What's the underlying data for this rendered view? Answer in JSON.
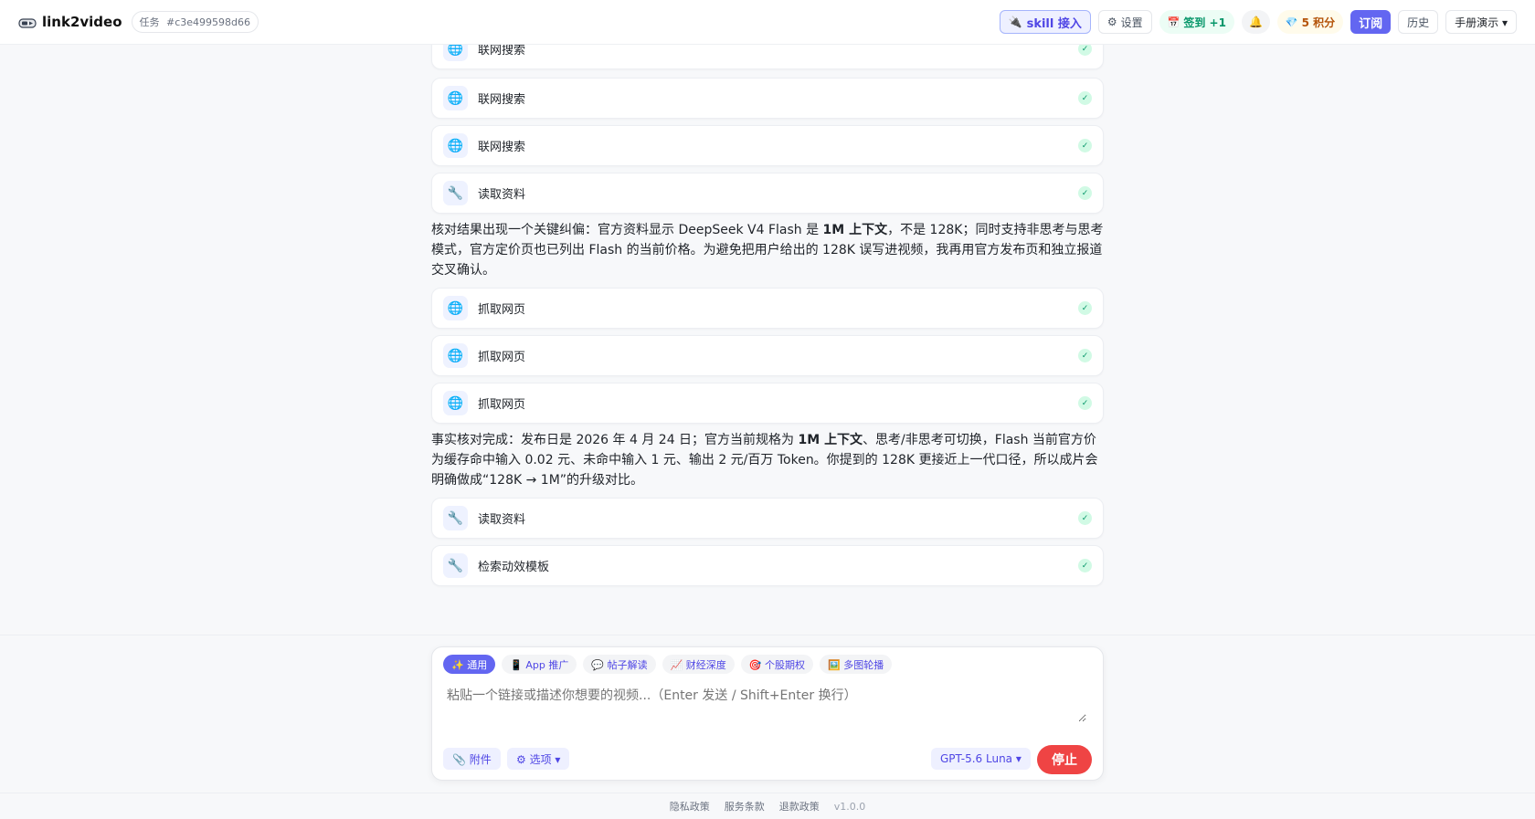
{
  "header": {
    "app_name": "link2video",
    "task_label": "任务",
    "task_id": "#c3e499598d66",
    "skill_label": "skill 接入",
    "settings_label": "设置",
    "checkin_label": "签到 +1",
    "points_label": "5 积分",
    "subscribe_label": "订阅",
    "history_label": "历史",
    "manual_label": "手册演示 ▾"
  },
  "tools": [
    {
      "label": "联网搜索",
      "icon": "globe-icon"
    },
    {
      "label": "联网搜索",
      "icon": "globe-icon"
    },
    {
      "label": "联网搜索",
      "icon": "globe-icon"
    },
    {
      "label": "读取资料",
      "icon": "wrench-icon"
    },
    {
      "label": "抓取网页",
      "icon": "globe-icon"
    },
    {
      "label": "抓取网页",
      "icon": "globe-icon"
    },
    {
      "label": "抓取网页",
      "icon": "globe-icon"
    },
    {
      "label": "读取资料",
      "icon": "wrench-icon"
    },
    {
      "label": "检索动效模板",
      "icon": "wrench-icon"
    }
  ],
  "messages": {
    "m1_a": "核对结果出现一个关键纠偏：官方资料显示 DeepSeek V4 Flash 是 ",
    "m1_bold": "1M 上下文",
    "m1_b": "，不是 128K；同时支持非思考与思考模式，官方定价页也已列出 Flash 的当前价格。为避免把用户给出的 128K 误写进视频，我再用官方发布页和独立报道交叉确认。",
    "m2_a": "事实核对完成：发布日是 2026 年 4 月 24 日；官方当前规格为 ",
    "m2_bold": "1M 上下文",
    "m2_b": "、思考/非思考可切换，Flash 当前官方价为缓存命中输入 0.02 元、未命中输入 1 元、输出 2 元/百万 Token。你提到的 128K 更接近上一代口径，所以成片会明确做成“128K → 1M”的升级对比。"
  },
  "composer": {
    "modes": [
      {
        "label": "✨ 通用"
      },
      {
        "label": "📱 App 推广"
      },
      {
        "label": "💬 帖子解读"
      },
      {
        "label": "📈 财经深度"
      },
      {
        "label": "🎯 个股期权"
      },
      {
        "label": "🖼️ 多图轮播"
      }
    ],
    "placeholder": "粘贴一个链接或描述你想要的视频...（Enter 发送 / Shift+Enter 换行）",
    "attach_label": "📎 附件",
    "options_label": "⚙ 选项 ▾",
    "model_label": "GPT-5.6 Luna ▾",
    "stop_label": "停止"
  },
  "footer": {
    "privacy": "隐私政策",
    "terms": "服务条款",
    "refund": "退款政策",
    "version": "v1.0.0"
  },
  "colors": {
    "accent": "#6366f1",
    "stop": "#ef4444",
    "success": "#059669"
  }
}
